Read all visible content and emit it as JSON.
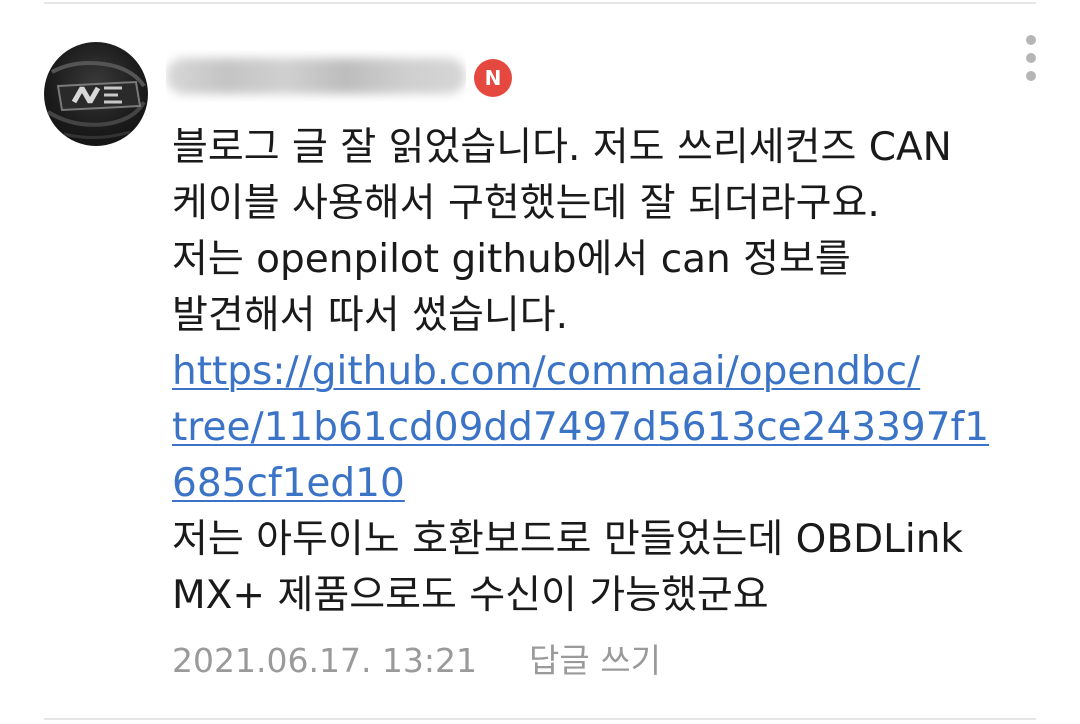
{
  "comment": {
    "author": {
      "name": "",
      "avatar_icon": "car-badge-icon",
      "badge": "N",
      "badge_color": "#e5483f"
    },
    "more_icon": "vertical-ellipsis-icon",
    "lines": [
      "블로그 글 잘 읽었습니다. 저도 쓰리세컨즈 CAN",
      "케이블 사용해서 구현했는데 잘 되더라구요.",
      "저는 openpilot github에서 can 정보를",
      "발견해서 따서 썼습니다."
    ],
    "link_lines": [
      "https://github.com/commaai/opendbc/",
      "tree/11b61cd09dd7497d5613ce243397f1",
      "685cf1ed10"
    ],
    "lines_after": [
      "저는 아두이노 호환보드로 만들었는데 OBDLink",
      "MX+ 제품으로도 수신이 가능했군요"
    ],
    "link_color": "#3b73c7",
    "timestamp": "2021.06.17. 13:21",
    "reply_label": "답글 쓰기"
  }
}
